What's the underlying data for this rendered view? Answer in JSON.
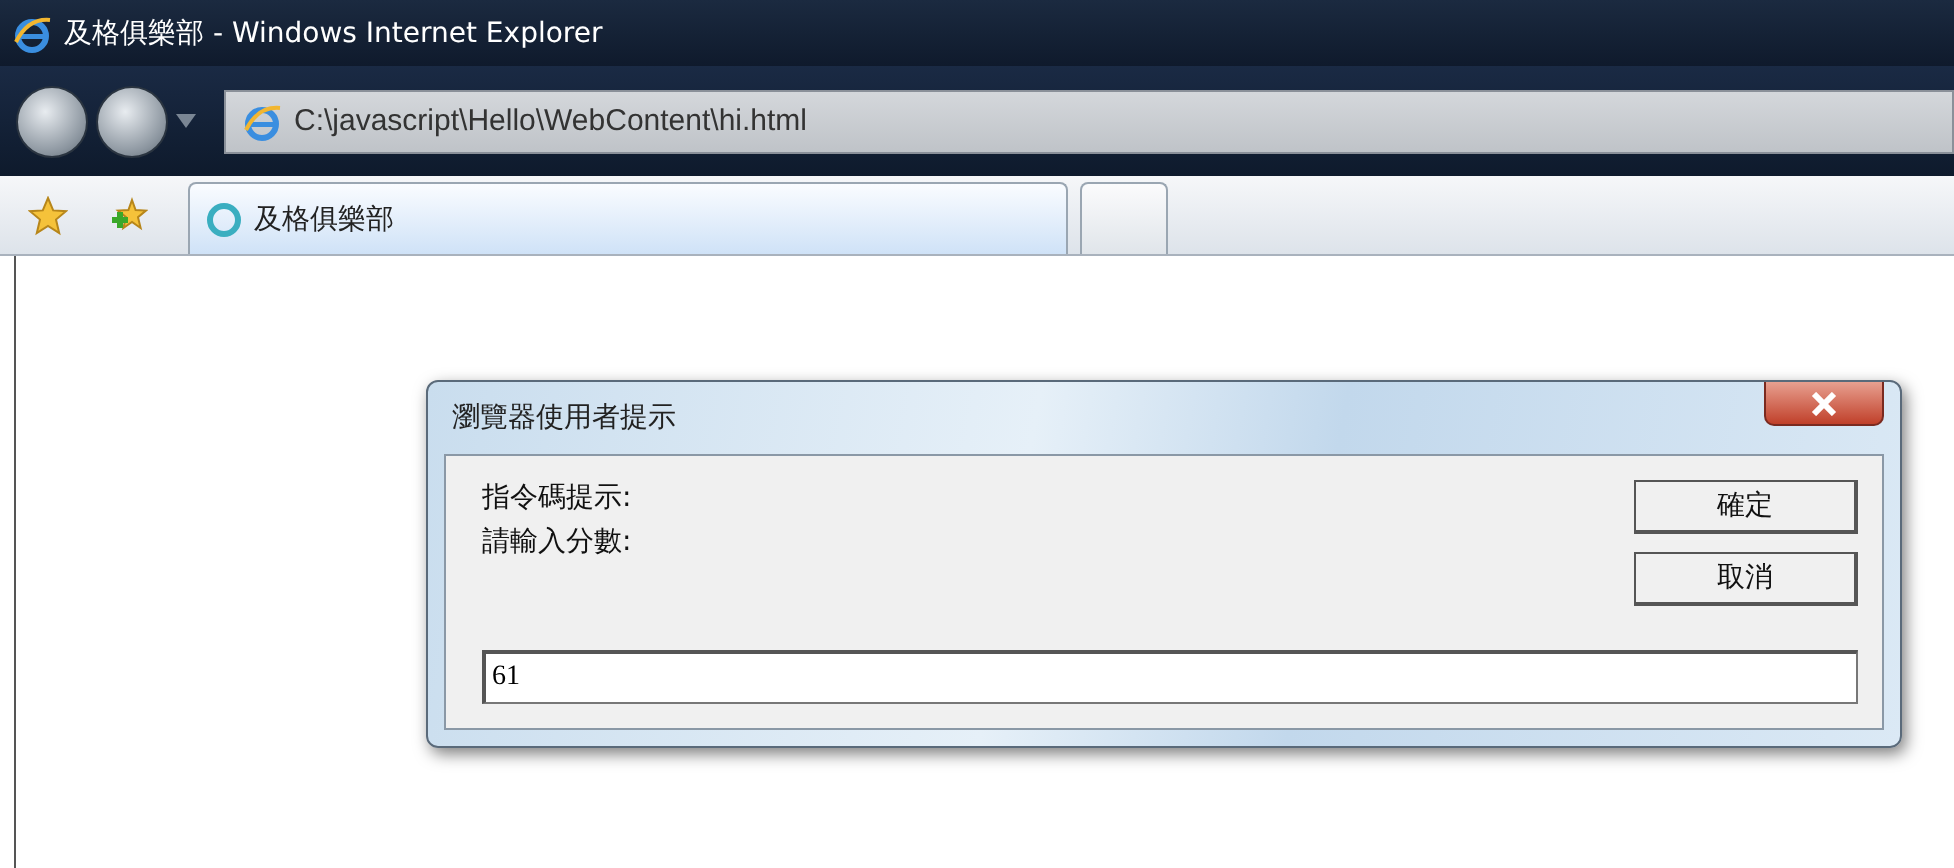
{
  "window": {
    "title": "及格俱樂部 - Windows Internet Explorer"
  },
  "address_bar": {
    "value": "C:\\javascript\\Hello\\WebContent\\hi.html"
  },
  "tabs": [
    {
      "label": "及格俱樂部",
      "selected": true
    },
    {
      "selected": false
    }
  ],
  "dialog": {
    "title": "瀏覽器使用者提示",
    "lines": [
      "指令碼提示:",
      "請輸入分數:"
    ],
    "buttons": [
      "確定",
      "取消"
    ],
    "input": {
      "value": "61"
    }
  }
}
